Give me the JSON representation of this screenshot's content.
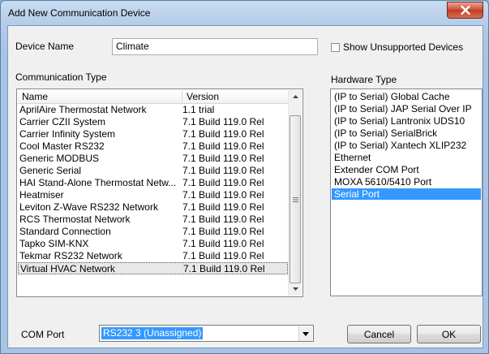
{
  "window": {
    "title": "Add New Communication Device"
  },
  "device_name": {
    "label": "Device Name",
    "value": "Climate"
  },
  "show_unsupported": {
    "label": "Show Unsupported Devices",
    "checked": false
  },
  "communication_type": {
    "label": "Communication Type",
    "columns": [
      "Name",
      "Version"
    ],
    "rows": [
      {
        "name": "AprilAire Thermostat Network",
        "version": "1.1 trial"
      },
      {
        "name": "Carrier CZII System",
        "version": "7.1 Build 119.0 Rel"
      },
      {
        "name": "Carrier Infinity System",
        "version": "7.1 Build 119.0 Rel"
      },
      {
        "name": "Cool Master RS232",
        "version": "7.1 Build 119.0 Rel"
      },
      {
        "name": "Generic MODBUS",
        "version": "7.1 Build 119.0 Rel"
      },
      {
        "name": "Generic Serial",
        "version": "7.1 Build 119.0 Rel"
      },
      {
        "name": "HAI Stand-Alone Thermostat Netw...",
        "version": "7.1 Build 119.0 Rel"
      },
      {
        "name": "Heatmiser",
        "version": "7.1 Build 119.0 Rel"
      },
      {
        "name": "Leviton Z-Wave RS232 Network",
        "version": "7.1 Build 119.0 Rel"
      },
      {
        "name": "RCS Thermostat Network",
        "version": "7.1 Build 119.0 Rel"
      },
      {
        "name": "Standard Connection",
        "version": "7.1 Build 119.0 Rel"
      },
      {
        "name": "Tapko SIM-KNX",
        "version": "7.1 Build 119.0 Rel"
      },
      {
        "name": "Tekmar RS232 Network",
        "version": "7.1 Build 119.0 Rel"
      },
      {
        "name": "Virtual HVAC Network",
        "version": "7.1 Build 119.0 Rel"
      }
    ],
    "selected_index": 13
  },
  "hardware_type": {
    "label": "Hardware Type",
    "items": [
      "(IP to Serial) Global Cache",
      "(IP to Serial) JAP Serial Over IP",
      "(IP to Serial) Lantronix UDS10",
      "(IP to Serial) SerialBrick",
      "(IP to Serial) Xantech XLIP232",
      "Ethernet",
      "Extender COM Port",
      "MOXA 5610/5410 Port",
      "Serial Port"
    ],
    "selected_index": 8
  },
  "com_port": {
    "label": "COM Port",
    "value": "RS232 3 (Unassigned)"
  },
  "buttons": {
    "cancel": "Cancel",
    "ok": "OK"
  },
  "colors": {
    "selection": "#3399ff",
    "close_button": "#c23b22"
  }
}
